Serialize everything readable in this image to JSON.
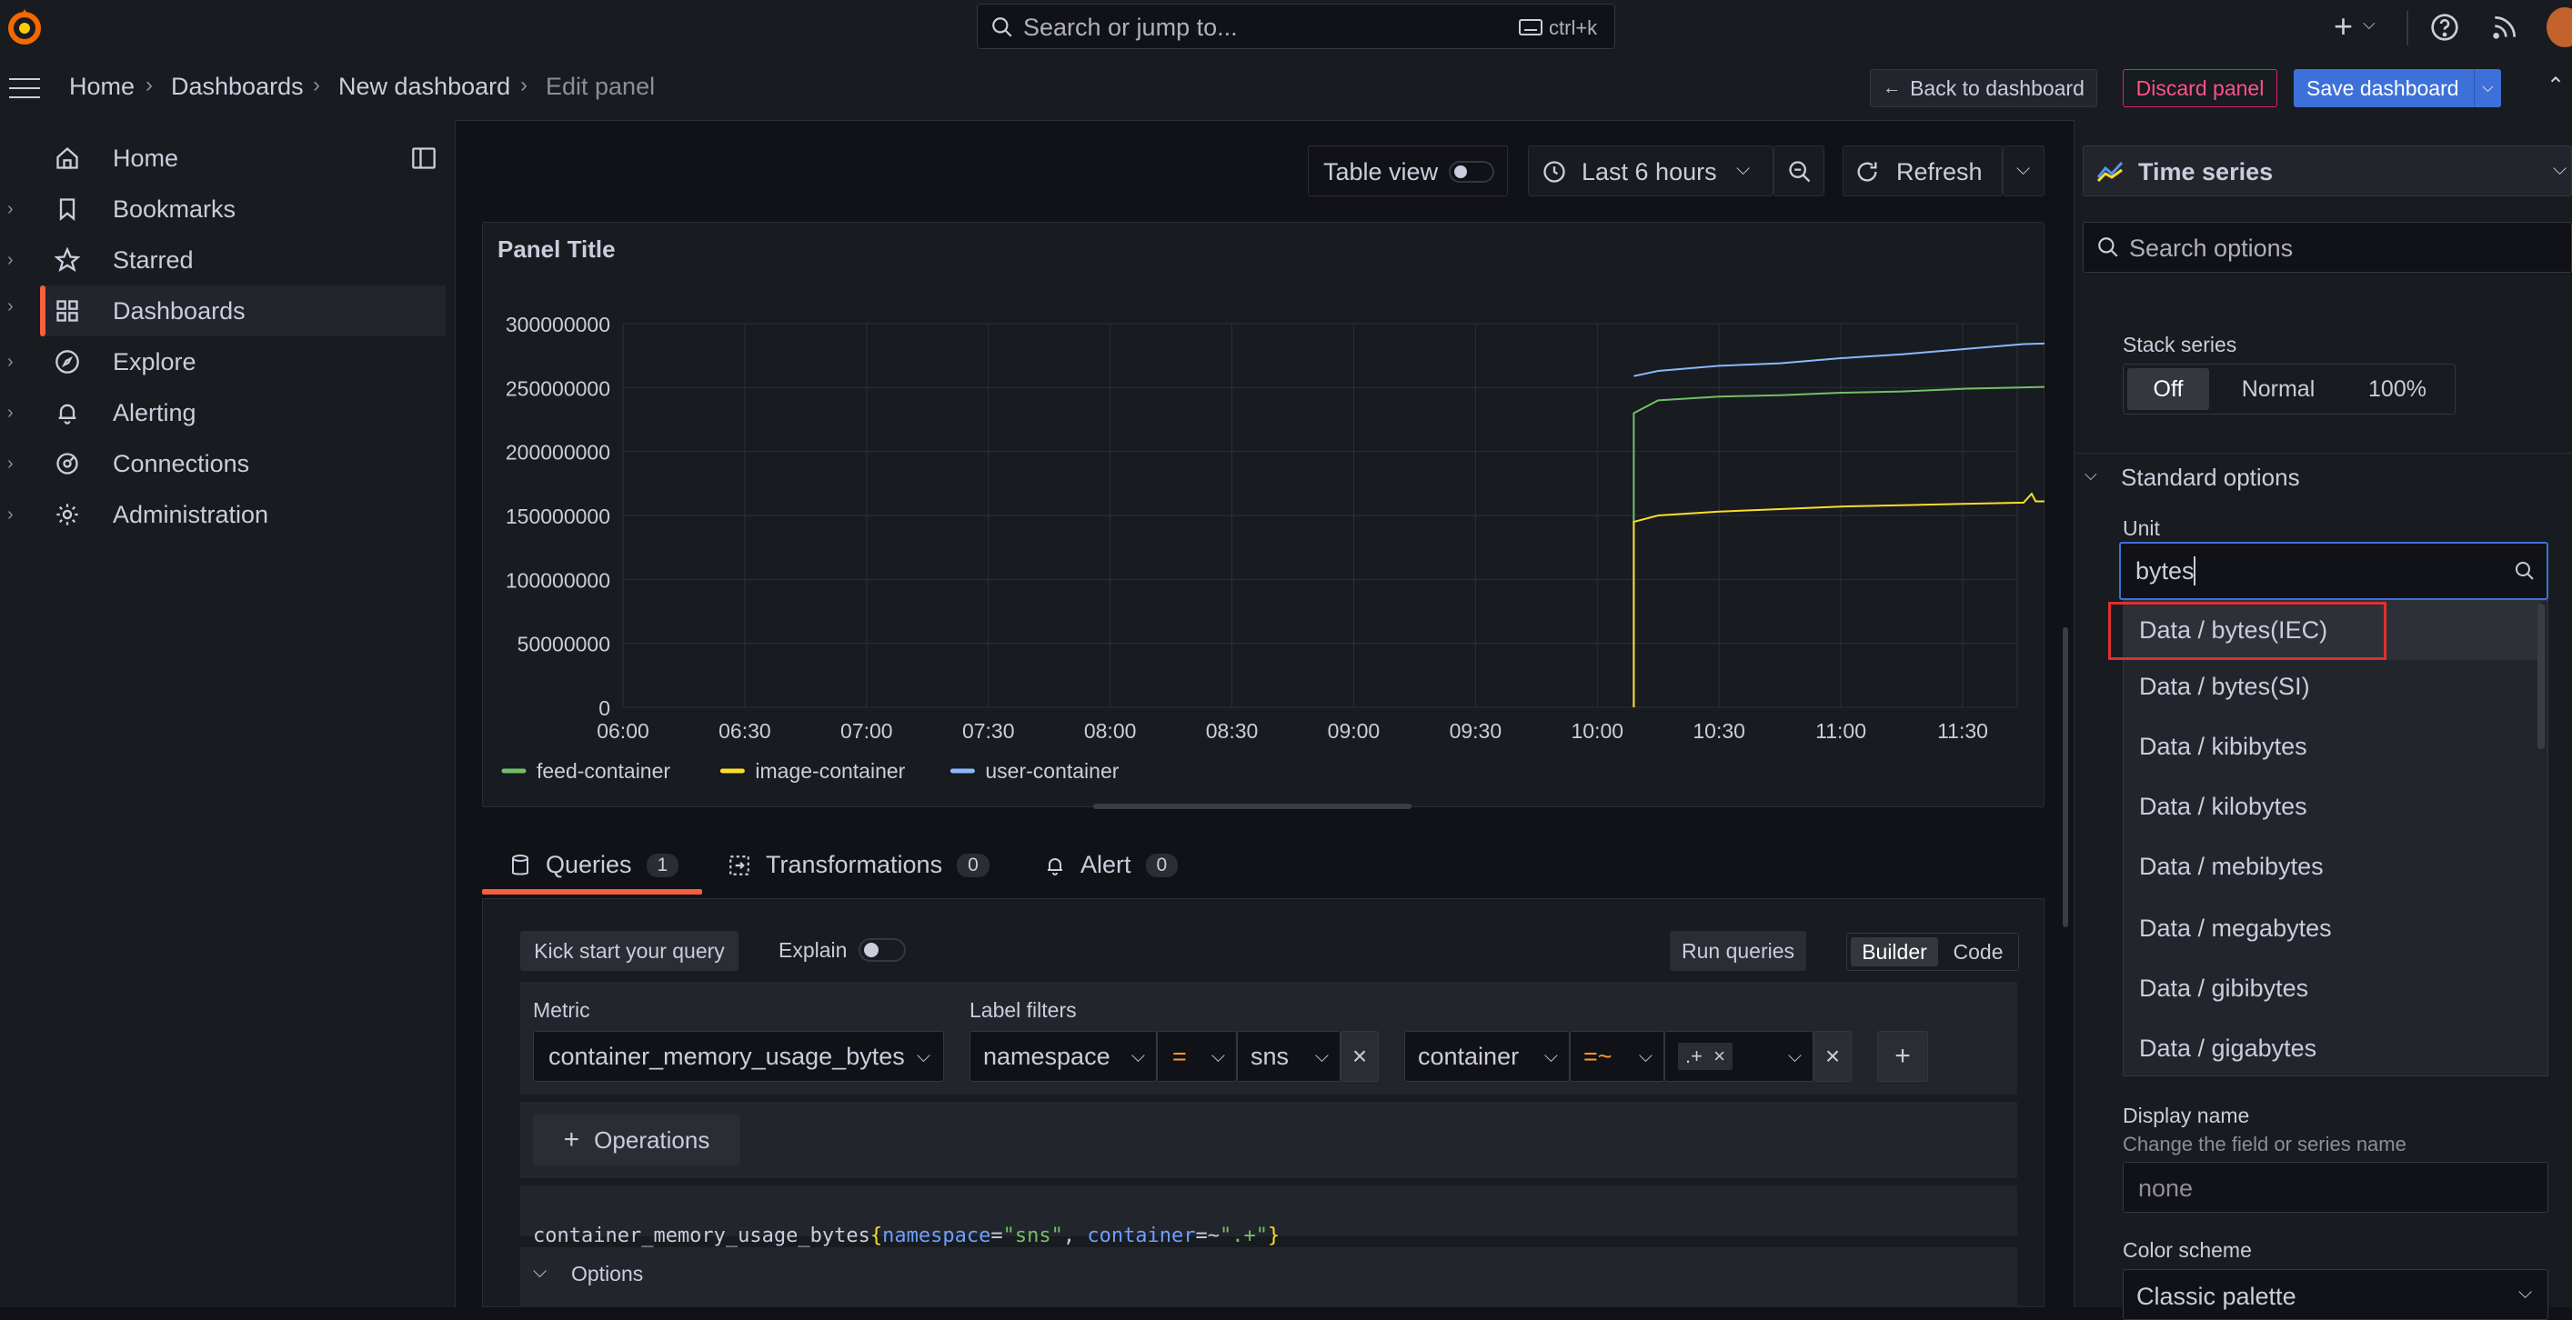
{
  "topbar": {
    "search_placeholder": "Search or jump to...",
    "search_shortcut": "ctrl+k",
    "plus_label": "+"
  },
  "breadcrumb": {
    "items": [
      "Home",
      "Dashboards",
      "New dashboard",
      "Edit panel"
    ],
    "back_label": "Back to dashboard",
    "discard_label": "Discard panel",
    "save_label": "Save dashboard"
  },
  "sidebar": {
    "items": [
      {
        "label": "Home",
        "icon": "home-icon"
      },
      {
        "label": "Bookmarks",
        "icon": "bookmark-icon"
      },
      {
        "label": "Starred",
        "icon": "star-icon"
      },
      {
        "label": "Dashboards",
        "icon": "dashboards-icon"
      },
      {
        "label": "Explore",
        "icon": "compass-icon"
      },
      {
        "label": "Alerting",
        "icon": "bell-icon"
      },
      {
        "label": "Connections",
        "icon": "connections-icon"
      },
      {
        "label": "Administration",
        "icon": "gear-icon"
      }
    ],
    "active_index": 3
  },
  "toolbar": {
    "table_view_label": "Table view",
    "time_range_label": "Last 6 hours",
    "refresh_label": "Refresh"
  },
  "panel": {
    "title": "Panel Title"
  },
  "chart_data": {
    "type": "line",
    "title": "Panel Title",
    "x_ticks": [
      "06:00",
      "06:30",
      "07:00",
      "07:30",
      "08:00",
      "08:30",
      "09:00",
      "09:30",
      "10:00",
      "10:30",
      "11:00",
      "11:30"
    ],
    "y_ticks": [
      "300000000",
      "250000000",
      "200000000",
      "150000000",
      "100000000",
      "50000000",
      "0"
    ],
    "ylim": [
      0,
      300000000
    ],
    "grid": true,
    "legend_position": "bottom-left",
    "series": [
      {
        "name": "feed-container",
        "color": "#73bf69",
        "points": [
          [
            "10:09",
            0
          ],
          [
            "10:09",
            230000000
          ],
          [
            "10:15",
            240000000
          ],
          [
            "10:30",
            243000000
          ],
          [
            "10:45",
            244000000
          ],
          [
            "11:00",
            246000000
          ],
          [
            "11:15",
            247000000
          ],
          [
            "11:30",
            249000000
          ],
          [
            "11:57",
            251000000
          ]
        ]
      },
      {
        "name": "image-container",
        "color": "#fade2a",
        "points": [
          [
            "10:09",
            0
          ],
          [
            "10:09",
            145000000
          ],
          [
            "10:15",
            150000000
          ],
          [
            "10:30",
            153000000
          ],
          [
            "10:45",
            155000000
          ],
          [
            "11:00",
            157000000
          ],
          [
            "11:15",
            158000000
          ],
          [
            "11:30",
            159000000
          ],
          [
            "11:45",
            160000000
          ],
          [
            "11:47",
            167000000
          ],
          [
            "11:48",
            161000000
          ],
          [
            "11:57",
            161000000
          ]
        ]
      },
      {
        "name": "user-container",
        "color": "#8ab8ff",
        "points": [
          [
            "10:09",
            259000000
          ],
          [
            "10:15",
            263000000
          ],
          [
            "10:30",
            267000000
          ],
          [
            "10:45",
            269000000
          ],
          [
            "11:00",
            273000000
          ],
          [
            "11:15",
            276000000
          ],
          [
            "11:30",
            280000000
          ],
          [
            "11:45",
            284000000
          ],
          [
            "11:57",
            285000000
          ]
        ]
      }
    ]
  },
  "tabs": [
    {
      "label": "Queries",
      "count": "1",
      "icon": "database-icon"
    },
    {
      "label": "Transformations",
      "count": "0",
      "icon": "transform-icon"
    },
    {
      "label": "Alert",
      "count": "0",
      "icon": "bell-icon"
    }
  ],
  "query": {
    "kick_start_label": "Kick start your query",
    "explain_label": "Explain",
    "run_label": "Run queries",
    "builder_label": "Builder",
    "code_label": "Code",
    "metric_label": "Metric",
    "metric_value": "container_memory_usage_bytes",
    "label_filters_label": "Label filters",
    "filter1_key": "namespace",
    "filter1_op": "=",
    "filter1_value": "sns",
    "filter2_key": "container",
    "filter2_op": "=~",
    "filter2_value": ".+",
    "operations_label": "Operations",
    "promql": {
      "metric": "container_memory_usage_bytes",
      "open": "{",
      "k1": "namespace",
      "eq1": "=",
      "v1": "\"sns\"",
      "comma": ", ",
      "k2": "container",
      "eq2": "=~",
      "v2": "\".+\"",
      "close": "}"
    },
    "options_label": "Options"
  },
  "rightpane": {
    "viz_label": "Time series",
    "search_placeholder": "Search options",
    "stack_series_label": "Stack series",
    "stack_options": [
      "Off",
      "Normal",
      "100%"
    ],
    "stack_selected": "Off",
    "standard_options_label": "Standard options",
    "unit_label": "Unit",
    "unit_value": "bytes",
    "unit_options": [
      "Data / bytes(IEC)",
      "Data / bytes(SI)",
      "Data / kibibytes",
      "Data / kilobytes",
      "Data / mebibytes",
      "Data / megabytes",
      "Data / gibibytes",
      "Data / gigabytes"
    ],
    "display_name_label": "Display name",
    "display_name_desc": "Change the field or series name",
    "display_name_placeholder": "none",
    "color_scheme_label": "Color scheme",
    "color_scheme_value": "Classic palette"
  }
}
